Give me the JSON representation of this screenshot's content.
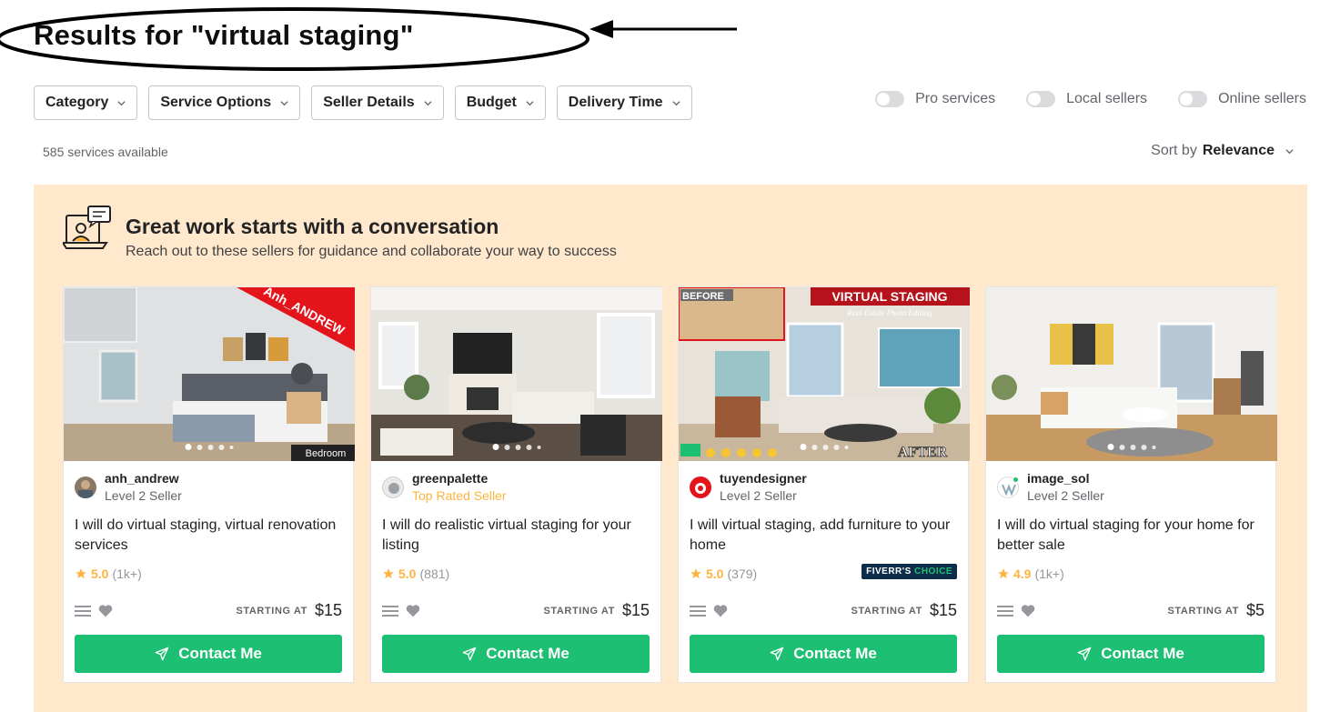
{
  "page_title": "Results for \"virtual staging\"",
  "filters": [
    {
      "label": "Category"
    },
    {
      "label": "Service Options"
    },
    {
      "label": "Seller Details"
    },
    {
      "label": "Budget"
    },
    {
      "label": "Delivery Time"
    }
  ],
  "toggles": [
    {
      "label": "Pro services"
    },
    {
      "label": "Local sellers"
    },
    {
      "label": "Online sellers"
    }
  ],
  "results_count": "585 services available",
  "sort": {
    "prefix": "Sort by",
    "value": "Relevance"
  },
  "banner": {
    "title": "Great work starts with a conversation",
    "subtitle": "Reach out to these sellers for guidance and collaborate your way to success"
  },
  "cards": [
    {
      "seller": "anh_andrew",
      "level": "Level 2 Seller",
      "title": "I will do virtual staging, virtual renovation services",
      "rating": "5.0",
      "reviews": "(1k+)",
      "price_label": "STARTING AT",
      "price": "$15",
      "contact": "Contact Me",
      "image_ribbon": "Anh_ANDREW",
      "image_caption": "Bedroom"
    },
    {
      "seller": "greenpalette",
      "level": "Top Rated Seller",
      "title": "I will do realistic virtual staging for your listing",
      "rating": "5.0",
      "reviews": "(881)",
      "price_label": "STARTING AT",
      "price": "$15",
      "contact": "Contact Me"
    },
    {
      "seller": "tuyendesigner",
      "level": "Level 2 Seller",
      "title": "I will virtual staging, add furniture to your home",
      "rating": "5.0",
      "reviews": "(379)",
      "price_label": "STARTING AT",
      "price": "$15",
      "contact": "Contact Me",
      "badge_a": "FIVERR'S",
      "badge_b": "CHOICE",
      "image_banner": "VIRTUAL STAGING",
      "image_before": "BEFORE",
      "image_after": "AFTER",
      "image_sub": "Real Estate Photo Editing"
    },
    {
      "seller": "image_sol",
      "level": "Level 2 Seller",
      "title": "I will do virtual staging for your home for better sale",
      "rating": "4.9",
      "reviews": "(1k+)",
      "price_label": "STARTING AT",
      "price": "$5",
      "contact": "Contact Me"
    }
  ],
  "colors": {
    "accent_green": "#1dbf73",
    "star": "#ffb33e",
    "banner_bg": "#ffe8cc"
  }
}
